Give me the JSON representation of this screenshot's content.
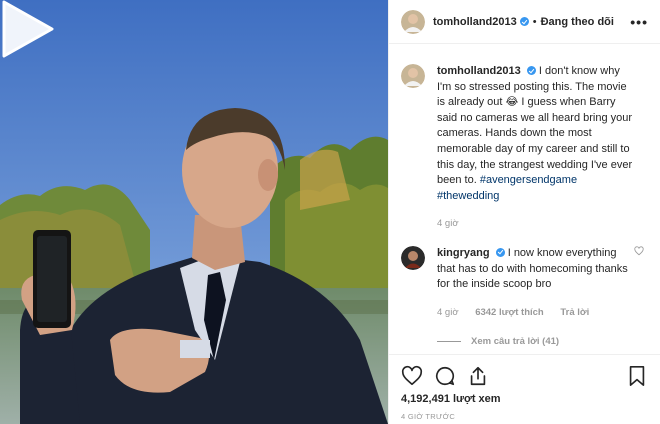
{
  "header": {
    "username": "tomholland2013",
    "separator": "•",
    "follow_status": "Đang theo dõi",
    "more": "•••"
  },
  "caption": {
    "username": "tomholland2013",
    "text": "I don't know why I'm so stressed posting this. The movie is already out 😂 I guess when Barry said no cameras we all heard bring your cameras. Hands down the most memorable day of my career and still to this day, the strangest wedding I've ever been to.",
    "hashtag1": "#avengersendgame",
    "hashtag2": "#thewedding",
    "time": "4 giờ"
  },
  "comment": {
    "username": "kingryang",
    "text": "I now know everything that has to do with homecoming thanks for the inside scoop bro",
    "time": "4 giờ",
    "likes": "6342 lượt thích",
    "reply": "Trả lời",
    "view_replies": "Xem câu trả lời (41)"
  },
  "footer": {
    "views": "4,192,491 lượt xem",
    "posted": "4 GIỜ TRƯỚC"
  },
  "icons": {
    "like": "heart-icon",
    "comment": "comment-icon",
    "share": "share-icon",
    "save": "bookmark-icon",
    "play": "play-icon",
    "verified": "verified-badge-icon"
  },
  "colors": {
    "verified": "#3897f0",
    "hashtag": "#003569",
    "muted": "#999999",
    "text": "#262626"
  }
}
